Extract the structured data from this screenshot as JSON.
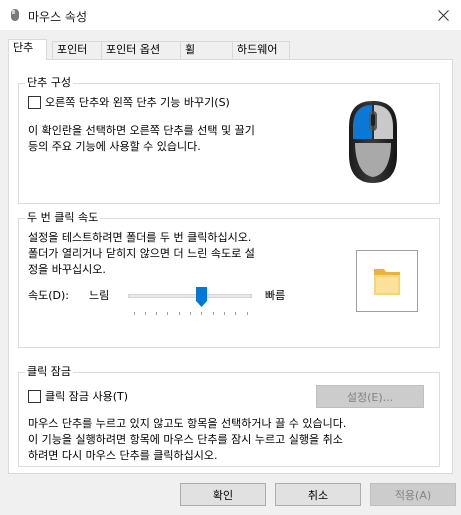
{
  "window": {
    "title": "마우스 속성",
    "app_icon": "mouse-settings-icon",
    "close_icon": "close-icon"
  },
  "tabs": [
    {
      "label": "단추",
      "active": true
    },
    {
      "label": "포인터",
      "active": false
    },
    {
      "label": "포인터 옵션",
      "active": false
    },
    {
      "label": "휠",
      "active": false
    },
    {
      "label": "하드웨어",
      "active": false
    }
  ],
  "button_config": {
    "group_label": "단추 구성",
    "swap_checkbox_label": "오른쪽 단추와 왼쪽 단추 기능 바꾸기(S)",
    "swap_checked": false,
    "description_line1": "이 확인란을 선택하면 오른쪽 단추를 선택 및 끌기",
    "description_line2": "등의 주요 기능에 사용할 수 있습니다.",
    "illustration_icon": "mouse-illustration-icon"
  },
  "double_click": {
    "group_label": "두 번 클릭 속도",
    "description_line1": "설정을 테스트하려면 폴더를 두 번 클릭하십시오.",
    "description_line2": "폴더가 열리거나 닫히지 않으면 더 느린 속도로 설",
    "description_line3": "정을 바꾸십시오.",
    "speed_label": "속도(D):",
    "slow_label": "느림",
    "fast_label": "빠름",
    "slider_value_fraction": 0.6,
    "slider_ticks": 11,
    "test_folder_icon": "folder-icon"
  },
  "click_lock": {
    "group_label": "클릭 잠금",
    "checkbox_label": "클릭 잠금 사용(T)",
    "checked": false,
    "settings_button": "설정(E)...",
    "description_line1": "마우스 단추를 누르고 있지 않고도 항목을 선택하거나 끌 수 있습니다.",
    "description_line2": "이 기능을 실행하려면 항목에 마우스 단추를 잠시 누르고 실행을 취소",
    "description_line3": "하려면 다시 마우스 단추를 클릭하십시오."
  },
  "footer": {
    "ok": "확인",
    "cancel": "취소",
    "apply": "적용(A)"
  },
  "colors": {
    "accent_blue": "#0078d7",
    "dialog_bg": "#f0f0f0"
  }
}
